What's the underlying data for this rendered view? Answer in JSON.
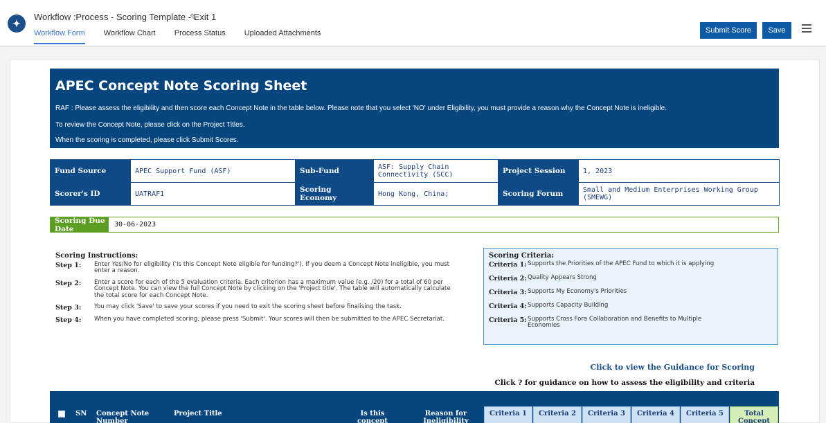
{
  "header": {
    "title": "Workflow :Process - Scoring Template - Exit 1",
    "tabs": [
      "Workflow Form",
      "Workflow Chart",
      "Process Status",
      "Uploaded Attachments"
    ],
    "submit_label": "Submit Score",
    "save_label": "Save",
    "accent_color": "#0f5aa6"
  },
  "banner": {
    "title": "APEC Concept Note Scoring Sheet",
    "line1": "RAF : Please assess the eligibility and then score each Concept Note in the table below. Please note that you select 'NO' under Eligibility, you must provide a reason why the Concept Note is ineligible.",
    "line2": "To review the Concept Note, please click on the Project Titles.",
    "line3": "When the scoring is completed, please click Submit Scores."
  },
  "info": {
    "fund_source_label": "Fund Source",
    "fund_source": "APEC Support Fund (ASF)",
    "sub_fund_label": "Sub-Fund",
    "sub_fund": "ASF: Supply Chain Connectivity (SCC)",
    "project_session_label": "Project Session",
    "project_session": "1, 2023",
    "scorer_id_label": "Scorer's ID",
    "scorer_id": "UATRAF1",
    "scoring_economy_label": "Scoring Economy",
    "scoring_economy": "Hong Kong, China;",
    "scoring_forum_label": "Scoring Forum",
    "scoring_forum": "Small and Medium Enterprises Working Group (SMEWG)",
    "due_label": "Scoring Due Date",
    "due_value": "30-06-2023"
  },
  "instructions": {
    "title": "Scoring Instructions:",
    "steps": [
      {
        "key": "Step 1:",
        "text": "Enter Yes/No for eligibility ('Is this Concept Note eligible for funding?'). If you deem a Concept Note ineligible, you must enter a reason."
      },
      {
        "key": "Step 2:",
        "text": "Enter a score for each of the 5 evaluation criteria. Each criterion has a maximum value (e.g. /20) for a total of 60 per Concept Note. You can view the full Concept Note by clicking on the 'Project title'. The table will automatically calculate the total score for each Concept Note."
      },
      {
        "key": "Step 3:",
        "text": "You may click 'Save' to save your scores if you need to exit the scoring sheet before finalising the task."
      },
      {
        "key": "Step 4:",
        "text": "When you have completed scoring, please press 'Submit'. Your scores will then be submitted to the APEC Secretariat."
      }
    ]
  },
  "criteria": {
    "title": "Scoring Criteria:",
    "items": [
      {
        "key": "Criteria 1:",
        "text": "Supports the Priorities of the APEC Fund to which it is applying"
      },
      {
        "key": "Criteria 2:",
        "text": "Quality Appears Strong"
      },
      {
        "key": "Criteria 3:",
        "text": "Supports My Economy's Priorities"
      },
      {
        "key": "Criteria 4:",
        "text": "Supports Capacity Building"
      },
      {
        "key": "Criteria 5:",
        "text": "Supports Cross Fora Collaboration and Benefits to Multiple Economies"
      }
    ]
  },
  "guidance": {
    "link": "Click to view the Guidance for Scoring",
    "note": "Click ? for guidance on how to assess the eligibility and criteria"
  },
  "table_header": {
    "sn": "SN",
    "concept_note": "Concept Note Number",
    "project_title": "Project Title",
    "eligible": "Is this concept",
    "reason": "Reason for Ineligibility",
    "c1": "Criteria 1",
    "c2": "Criteria 2",
    "c3": "Criteria 3",
    "c4": "Criteria 4",
    "c5": "Criteria 5",
    "total": "Total Concept"
  }
}
